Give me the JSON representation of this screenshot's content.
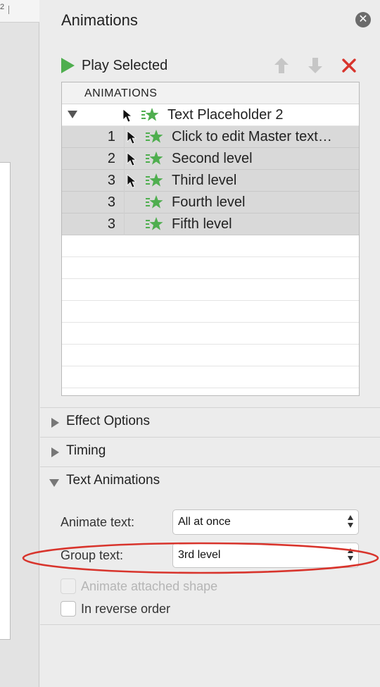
{
  "ruler": {
    "number": "2"
  },
  "pane": {
    "title": "Animations"
  },
  "toolbar": {
    "play_label": "Play Selected"
  },
  "list": {
    "header": "ANIMATIONS",
    "parent": {
      "label": "Text Placeholder 2"
    },
    "items": [
      {
        "order": "1",
        "label": "Click to edit Master text…",
        "on_click": true
      },
      {
        "order": "2",
        "label": "Second level",
        "on_click": true
      },
      {
        "order": "3",
        "label": "Third level",
        "on_click": true
      },
      {
        "order": "3",
        "label": "Fourth level",
        "on_click": false
      },
      {
        "order": "3",
        "label": "Fifth level",
        "on_click": false
      }
    ]
  },
  "sections": {
    "effect_options": "Effect Options",
    "timing": "Timing",
    "text_animations": "Text Animations"
  },
  "text_animations": {
    "animate_text_label": "Animate text:",
    "animate_text_value": "All at once",
    "group_text_label": "Group text:",
    "group_text_value": "3rd level",
    "animate_attached_shape_label": "Animate attached shape",
    "reverse_order_label": "In reverse order"
  },
  "colors": {
    "accent_green": "#4fae4f",
    "delete_red": "#d8342c",
    "annotation_red": "#d8342c",
    "selected_row": "#d9d9d9"
  },
  "icons": {
    "close": "close-icon",
    "play": "play-icon",
    "move_up": "arrow-up-icon",
    "move_down": "arrow-down-icon",
    "delete": "delete-x-icon",
    "trigger": "mouse-cursor-icon",
    "effect": "star-effect-icon"
  }
}
